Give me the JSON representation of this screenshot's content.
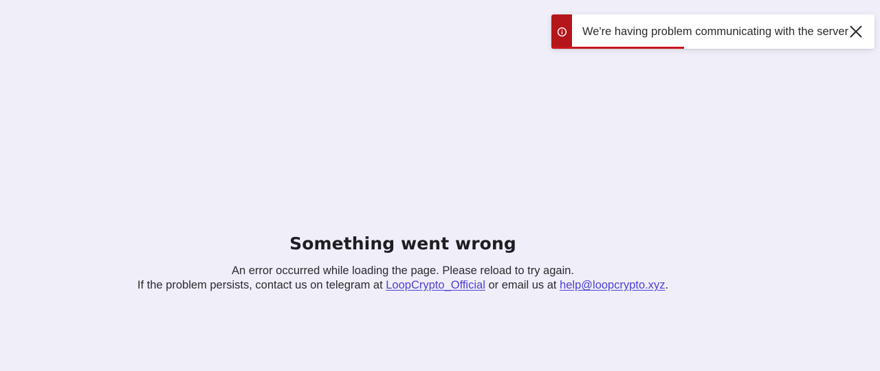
{
  "toast": {
    "message": "We're having problem communicating with the server",
    "progress_fraction": 0.41,
    "accent_color": "#b5161b",
    "icons": {
      "info": "info-circle-icon",
      "close": "close-icon"
    }
  },
  "error": {
    "title": "Something went wrong",
    "line1": "An error occurred while loading the page. Please reload to try again.",
    "line2_prefix": "If the problem persists, contact us on telegram at ",
    "telegram_link": "LoopCrypto_Official",
    "line2_middle": " or email us at ",
    "email_link": "help@loopcrypto.xyz",
    "line2_suffix": "."
  },
  "colors": {
    "background": "#f0eef8",
    "link": "#4b3fd6"
  }
}
